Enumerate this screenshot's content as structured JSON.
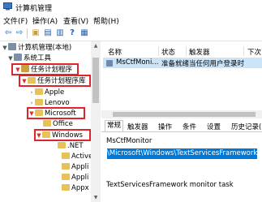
{
  "window": {
    "title": "计算机管理"
  },
  "menu": [
    {
      "label": "文件(F)"
    },
    {
      "label": "操作(A)"
    },
    {
      "label": "查看(V)"
    },
    {
      "label": "帮助(H)"
    }
  ],
  "toolbar": {
    "buttons": [
      {
        "icon": "back-arrow-icon",
        "glyph": "⇦"
      },
      {
        "icon": "forward-arrow-icon",
        "glyph": "⇨"
      },
      {
        "icon": "up-folder-icon",
        "glyph": "▣"
      },
      {
        "icon": "show-hide-tree-icon",
        "glyph": "▤"
      },
      {
        "icon": "properties-icon",
        "glyph": "▥"
      },
      {
        "icon": "help-icon",
        "glyph": "?"
      },
      {
        "icon": "console-icon",
        "glyph": "▦"
      }
    ]
  },
  "tree": {
    "root": "计算机管理(本地)",
    "system_tools": "系统工具",
    "task_scheduler": "任务计划程序",
    "task_library": "任务计划程序库",
    "apple": "Apple",
    "lenovo": "Lenovo",
    "microsoft": "Microsoft",
    "office": "Office",
    "windows": "Windows",
    "net": ".NET",
    "active": "Active",
    "appli1": "Appli",
    "appli2": "Appli",
    "appx": "Appx"
  },
  "list": {
    "columns": [
      "名称",
      "状态",
      "触发器",
      "下次"
    ],
    "rows": [
      {
        "name": "MsCtfMoni...",
        "status": "准备就绪",
        "trigger": "当任何用户登录时"
      }
    ]
  },
  "details": {
    "tabs": [
      "常规",
      "触发器",
      "操作",
      "条件",
      "设置",
      "历史记录("
    ],
    "name": "MsCtfMonitor",
    "location": "\\Microsoft\\Windows\\TextServicesFramework",
    "description": "TextServicesFramework monitor task"
  },
  "colors": {
    "highlight_border": "#e0242c",
    "selection_background": "#0078d7",
    "row_selected": "#cce4f7"
  }
}
